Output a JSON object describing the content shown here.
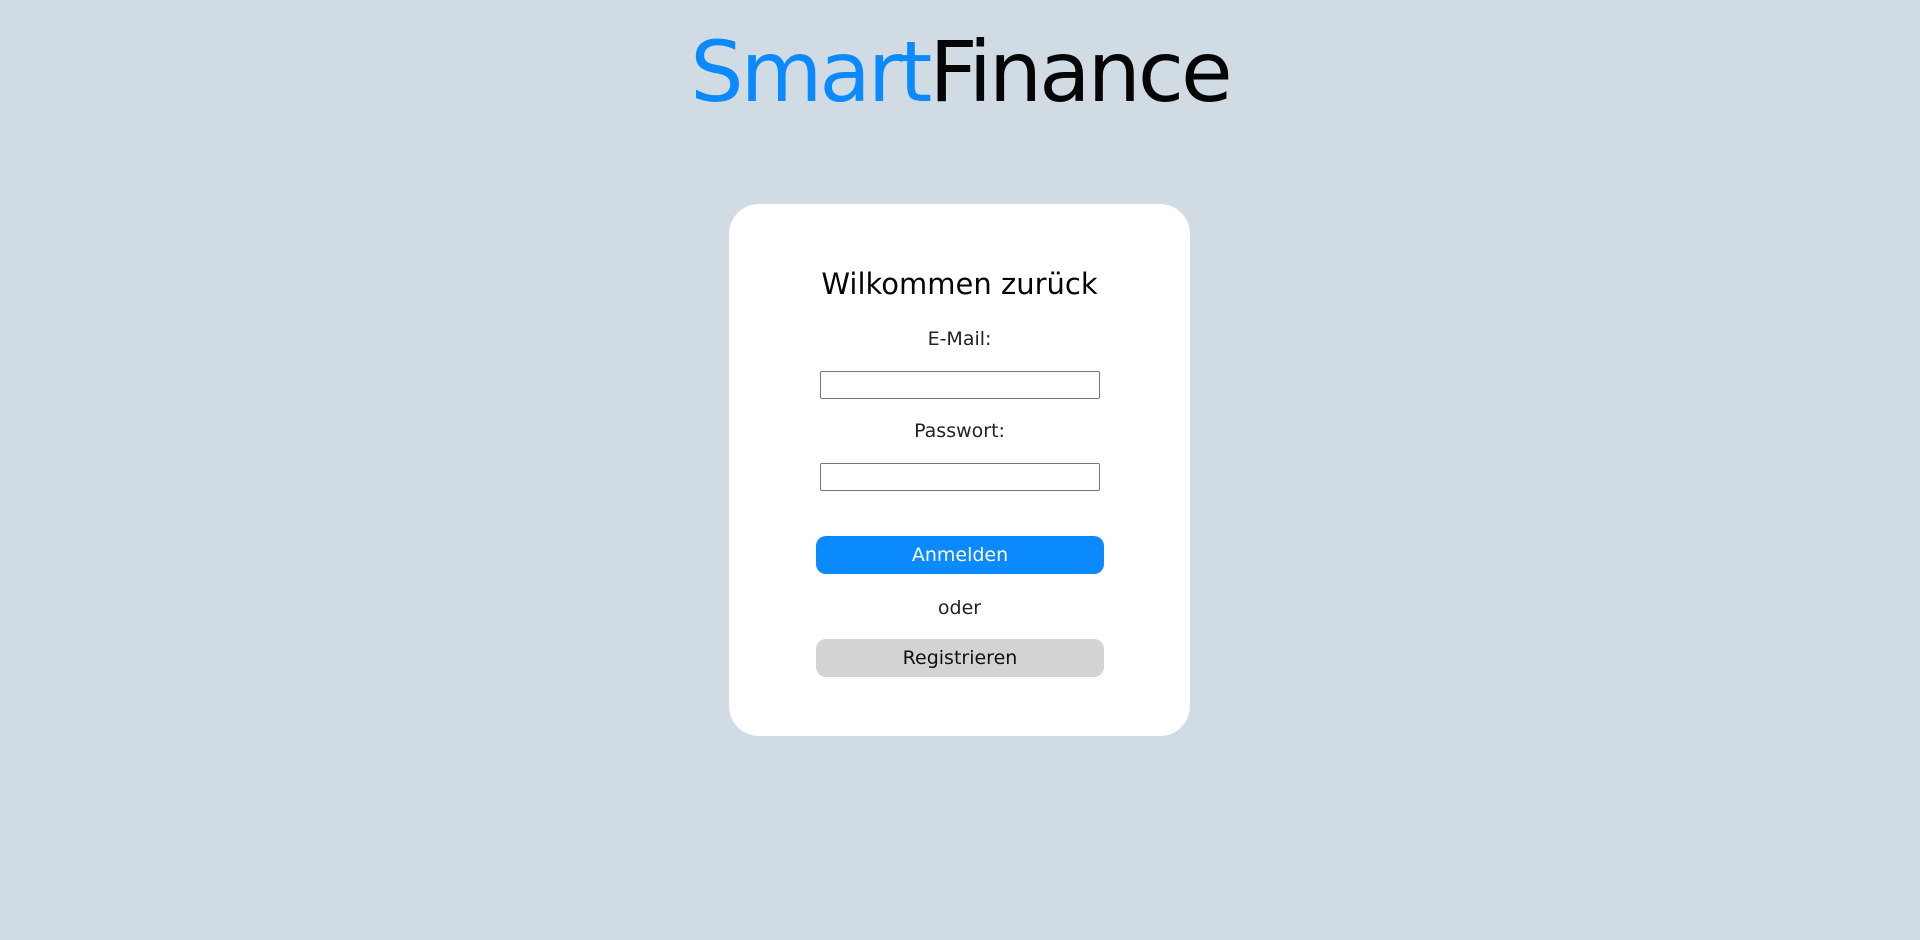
{
  "header": {
    "logo_part1": "Smart",
    "logo_part2": "Finance"
  },
  "login_card": {
    "title": "Wilkommen zurück",
    "email_label": "E-Mail:",
    "email_value": "",
    "password_label": "Passwort:",
    "password_value": "",
    "login_button": "Anmelden",
    "divider_text": "oder",
    "register_button": "Registrieren"
  },
  "colors": {
    "background": "#d0dbe4",
    "accent": "#0a8afc",
    "secondary_button": "#d3d3d3"
  }
}
